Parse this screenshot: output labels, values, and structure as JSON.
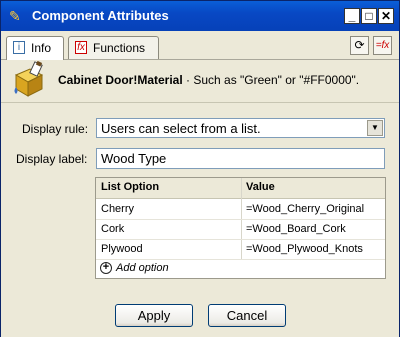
{
  "window": {
    "title": "Component Attributes"
  },
  "titlebar_buttons": {
    "minimize": "_",
    "maximize": "□",
    "close": "✕"
  },
  "tabs": [
    {
      "label": "Info",
      "icon": "info-icon"
    },
    {
      "label": "Functions",
      "icon": "functions-icon"
    }
  ],
  "toolbar": {
    "refresh_icon": "⟳",
    "formula_icon": "=fx"
  },
  "info": {
    "attribute_path": "Cabinet Door!Material",
    "hint": " · Such as \"Green\" or \"#FF0000\"."
  },
  "form": {
    "display_rule_label": "Display rule:",
    "display_rule_value": "Users can select from a list.",
    "display_label_label": "Display label:",
    "display_label_value": "Wood Type"
  },
  "options_table": {
    "columns": [
      "List Option",
      "Value"
    ],
    "rows": [
      {
        "option": "Cherry",
        "value": "=Wood_Cherry_Original"
      },
      {
        "option": "Cork",
        "value": "=Wood_Board_Cork"
      },
      {
        "option": "Plywood",
        "value": "=Wood_Plywood_Knots"
      }
    ],
    "add_label": "Add option"
  },
  "buttons": {
    "apply": "Apply",
    "cancel": "Cancel"
  },
  "colors": {
    "titlebar": "#0848c4",
    "accent_red": "#cc0000"
  }
}
